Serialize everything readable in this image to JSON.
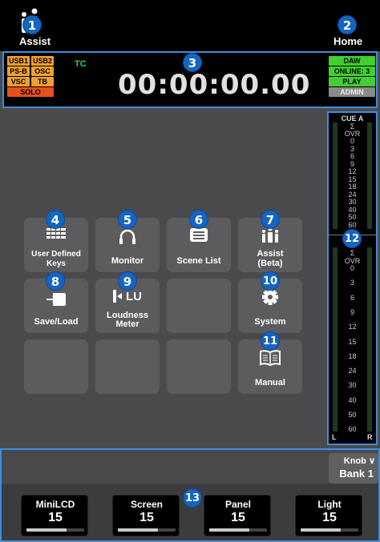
{
  "top": {
    "assist_label": "Assist",
    "home_label": "Home"
  },
  "status": {
    "tags_left": [
      {
        "label": "USB1",
        "color": "orange"
      },
      {
        "label": "USB2",
        "color": "orange"
      },
      {
        "label": "PS-B",
        "color": "orange"
      },
      {
        "label": "OSC",
        "color": "orange"
      },
      {
        "label": "VSC",
        "color": "orange"
      },
      {
        "label": "TB",
        "color": "orange"
      },
      {
        "label": "SOLO",
        "color": "red"
      }
    ],
    "tc_label": "TC",
    "timecode": "00:00:00.00",
    "tags_right": [
      {
        "label": "DAW",
        "color": "green"
      },
      {
        "label": "ONLINE: 3",
        "color": "green"
      },
      {
        "label": "PLAY",
        "color": "green"
      },
      {
        "label": "ADMIN",
        "color": "grey"
      }
    ]
  },
  "menu": {
    "user_defined_keys": "User Defined Keys",
    "monitor": "Monitor",
    "scene_list": "Scene List",
    "assist_beta_1": "Assist",
    "assist_beta_2": "(Beta)",
    "save_load": "Save/Load",
    "loudness_meter_1": "Loudness",
    "loudness_meter_2": "Meter",
    "system": "System",
    "manual": "Manual",
    "lu_glyph": "LU"
  },
  "meters": {
    "cue_title": "CUE A",
    "st_title": "ST A",
    "sigma": "Σ",
    "ovr": "OVR",
    "cue_scale": [
      "0",
      "3",
      "6",
      "9",
      "12",
      "15",
      "18",
      "24",
      "30",
      "40",
      "50",
      "60"
    ],
    "st_scale": [
      "0",
      "3",
      "6",
      "9",
      "12",
      "15",
      "18",
      "24",
      "30",
      "40",
      "50",
      "60"
    ],
    "left": "L",
    "right": "R"
  },
  "bottom": {
    "knob_label": "Knob",
    "bank_label": "Bank 1",
    "knobs": [
      {
        "name": "MiniLCD",
        "value": "15",
        "level": 0.7
      },
      {
        "name": "Screen",
        "value": "15",
        "level": 0.7
      },
      {
        "name": "Panel",
        "value": "15",
        "level": 0.7
      },
      {
        "name": "Light",
        "value": "15",
        "level": 0.7
      }
    ]
  },
  "callouts": [
    "1",
    "2",
    "3",
    "4",
    "5",
    "6",
    "7",
    "8",
    "9",
    "10",
    "11",
    "12",
    "13"
  ],
  "colors": {
    "callout": "#1565c0",
    "highlight": "#3a8fe0",
    "tag_orange": "#f0a030",
    "tag_red": "#e85020",
    "tag_green": "#40d030",
    "tc_green": "#30d040"
  }
}
